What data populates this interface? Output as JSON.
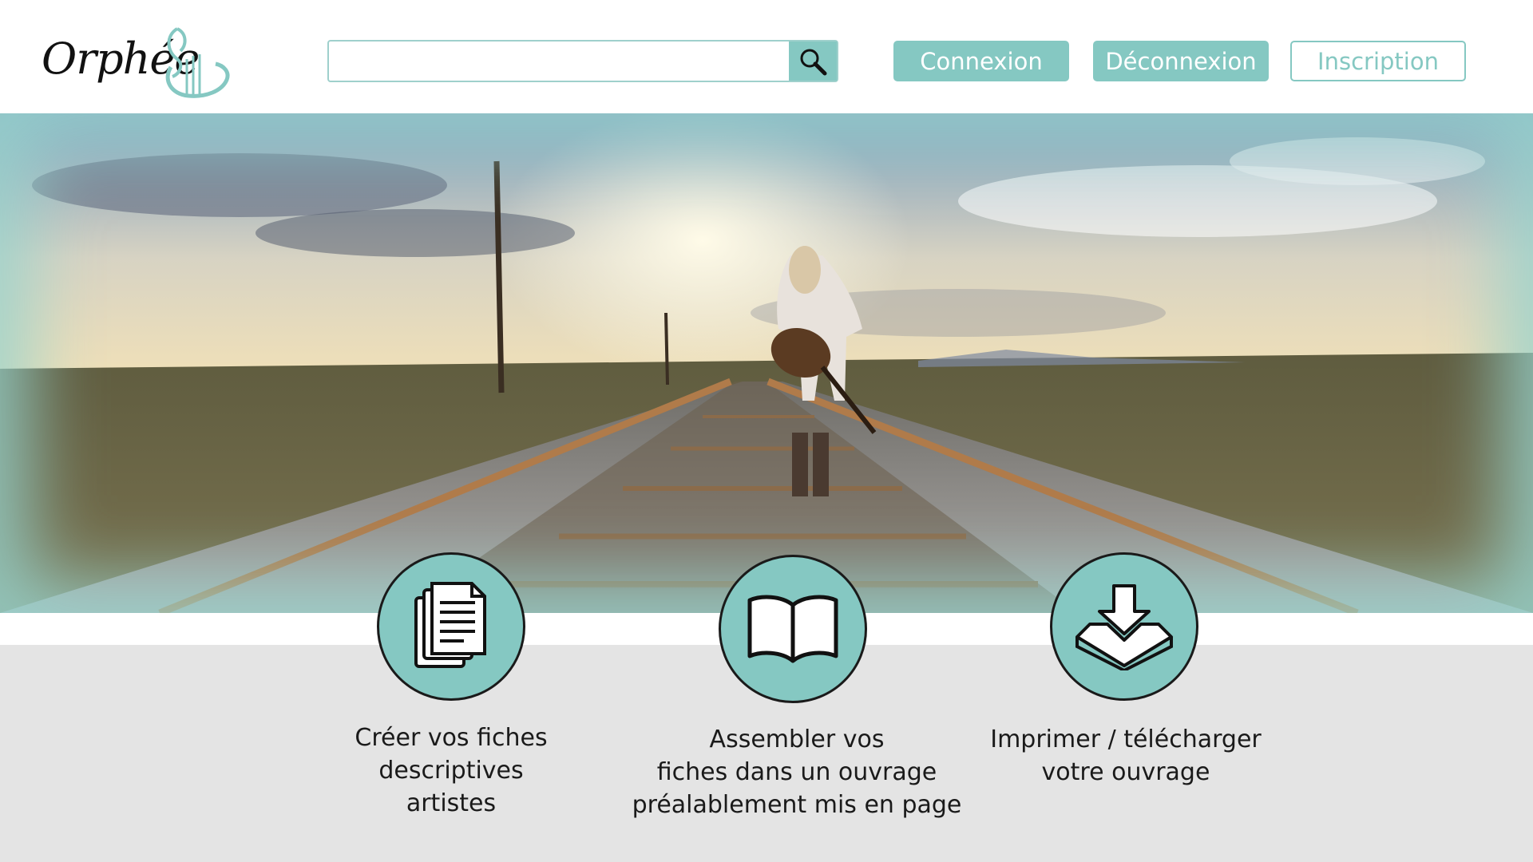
{
  "header": {
    "logo_text": "Orphée",
    "search": {
      "placeholder": "",
      "value": "",
      "icon": "search-icon"
    },
    "buttons": {
      "login": "Connexion",
      "logout": "Déconnexion",
      "register": "Inscription"
    }
  },
  "hero": {
    "image": "woman-with-guitar-walking-on-railway-tracks-at-sunset"
  },
  "features": [
    {
      "icon": "documents-icon",
      "lines": [
        "Créer vos fiches",
        "descriptives",
        "artistes"
      ]
    },
    {
      "icon": "open-book-icon",
      "lines": [
        "Assembler vos",
        "fiches dans un ouvrage",
        "préalablement mis en page"
      ]
    },
    {
      "icon": "download-icon",
      "lines": [
        "Imprimer / télécharger",
        "votre ouvrage"
      ]
    }
  ],
  "colors": {
    "accent": "#85c8c2",
    "band": "#e4e4e4",
    "text": "#1a1a1a"
  }
}
